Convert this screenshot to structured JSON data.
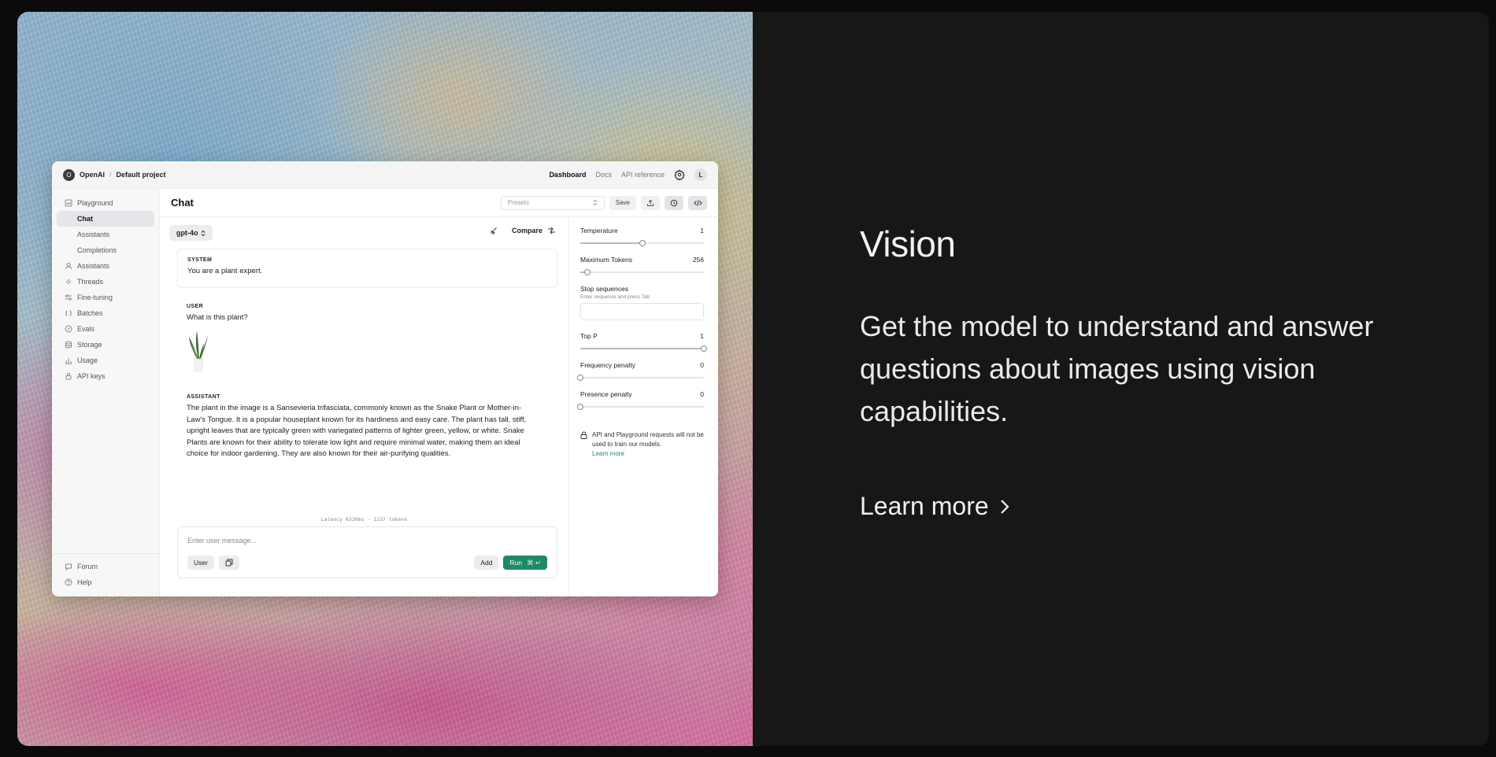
{
  "panel": {
    "title": "Vision",
    "description": "Get the model to understand and answer questions about images using vision capabilities.",
    "learn_more": "Learn more"
  },
  "app": {
    "org_initial": "O",
    "org": "OpenAI",
    "separator": "/",
    "project": "Default project",
    "nav": [
      "Dashboard",
      "Docs",
      "API reference"
    ],
    "user_initial": "L",
    "sidebar": {
      "playground": "Playground",
      "chat": "Chat",
      "assistants_sub": "Assistants",
      "completions": "Completions",
      "items": [
        "Assistants",
        "Threads",
        "Fine-tuning",
        "Batches",
        "Evals",
        "Storage",
        "Usage",
        "API keys"
      ],
      "bottom": [
        "Forum",
        "Help"
      ]
    },
    "page_title": "Chat",
    "presets_placeholder": "Presets",
    "save": "Save",
    "model": "gpt-4o",
    "compare": "Compare",
    "system_role": "SYSTEM",
    "system_text": "You are a plant expert.",
    "user_role": "USER",
    "user_text": "What is this plant?",
    "assistant_role": "ASSISTANT",
    "assistant_text": "The plant in the image is a Sansevieria trifasciata, commonly known as the Snake Plant or Mother-in-Law's Tongue. It is a popular houseplant known for its hardiness and easy care. The plant has tall, stiff, upright leaves that are typically green with variegated patterns of lighter green, yellow, or white. Snake Plants are known for their ability to tolerate low light and require minimal water, making them an ideal choice for indoor gardening. They are also known for their air-purifying qualities.",
    "latency": "Latency 6320ms · 1237 tokens",
    "composer_placeholder": "Enter user message...",
    "role_button": "User",
    "add": "Add",
    "run": "Run",
    "run_shortcut": "⌘ ↵",
    "params": {
      "temperature": {
        "label": "Temperature",
        "value": "1",
        "fraction": 0.5
      },
      "max_tokens": {
        "label": "Maximum Tokens",
        "value": "256",
        "fraction": 0.06
      },
      "stop_label": "Stop sequences",
      "stop_hint": "Enter sequence and press Tab",
      "top_p": {
        "label": "Top P",
        "value": "1",
        "fraction": 1.0
      },
      "frequency": {
        "label": "Frequency penalty",
        "value": "0",
        "fraction": 0.0
      },
      "presence": {
        "label": "Presence penalty",
        "value": "0",
        "fraction": 0.0
      }
    },
    "notice_text": "API and Playground requests will not be used to train our models.",
    "notice_link": "Learn more",
    "accent_color": "#1f8a64"
  }
}
